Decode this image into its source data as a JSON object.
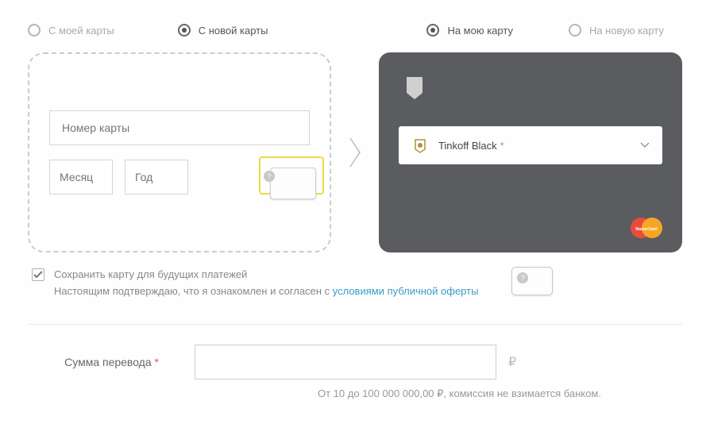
{
  "radios": {
    "from_my_card": "С моей карты",
    "from_new_card": "С новой карты",
    "to_my_card": "На мою карту",
    "to_new_card": "На новую карту"
  },
  "source_card": {
    "number_placeholder": "Номер карты",
    "month_placeholder": "Месяц",
    "year_placeholder": "Год"
  },
  "target_card": {
    "selected": "Tinkoff Black",
    "star": "*"
  },
  "save": {
    "line1": "Сохранить карту для будущих платежей",
    "line2": "Настоящим подтверждаю, что я ознакомлен и согласен с ",
    "link": "условиями публичной оферты"
  },
  "amount": {
    "label": "Сумма перевода",
    "required": "*",
    "currency": "₽",
    "hint": "От 10 до 100 000 000,00 ₽, комиссия не взимается банком."
  }
}
